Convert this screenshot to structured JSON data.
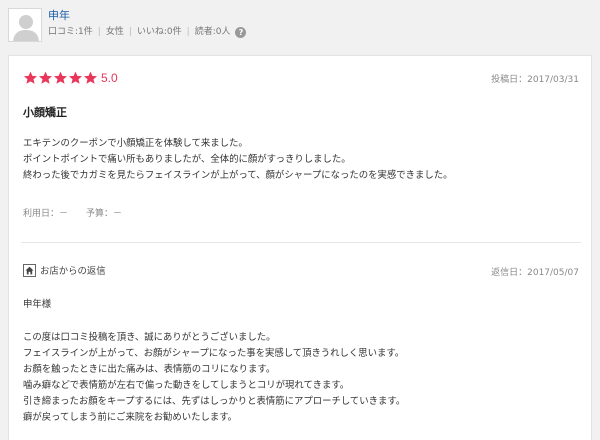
{
  "user": {
    "name": "申年",
    "reviews": "口コミ:1件",
    "gender": "女性",
    "likes": "いいね:0件",
    "readers": "読者:0人",
    "help_glyph": "?"
  },
  "review": {
    "rating_stars": 5,
    "rating_value": "5.0",
    "post_date": "投稿日：2017/03/31",
    "title": "小顔矯正",
    "body_lines": [
      "エキテンのクーポンで小顔矯正を体験して来ました。",
      "ポイントポイントで痛い所もありましたが、全体的に顔がすっきりしました。",
      "終わった後でカガミを見たらフェイスラインが上がって、顔がシャープになったのを実感できました。"
    ],
    "usage_date": "利用日：－",
    "budget": "予算：－"
  },
  "reply": {
    "label": "お店からの返信",
    "date": "返信日：2017/05/07",
    "greeting": "申年様",
    "body_lines": [
      "この度は口コミ投稿を頂き、誠にありがとうございました。",
      "フェイスラインが上がって、お顔がシャープになった事を実感して頂きうれしく思います。",
      "お顔を触ったときに出た痛みは、表情筋のコリになります。",
      "噛み癖などで表情筋が左右で偏った動きをしてしまうとコリが現れてきます。",
      "引き締まったお顔をキープするには、先ずはしっかりと表情筋にアプローチしていきます。",
      "癖が戻ってしまう前にご来院をお勧めいたします。"
    ]
  },
  "colors": {
    "star": "#e8375a",
    "link": "#1a5ea8"
  },
  "icons": {
    "avatar": "default-user-avatar",
    "help": "question-circle-icon",
    "shop": "shop-house-icon",
    "star": "star-icon"
  }
}
